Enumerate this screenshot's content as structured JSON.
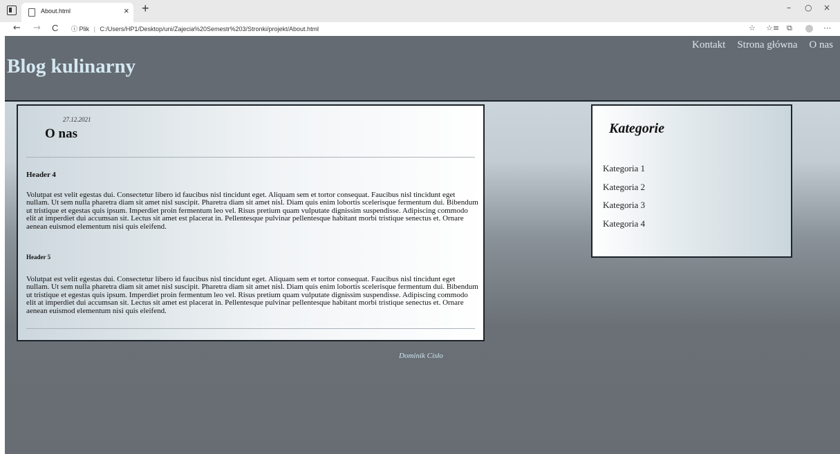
{
  "browser": {
    "tab_title": "About.html",
    "tab_close": "×",
    "new_tab": "+",
    "window_controls": [
      "–",
      "○",
      "×"
    ],
    "nav": [
      "←",
      "→",
      "C"
    ],
    "address_prefix": "Plik",
    "address": "C:/Users/HP1/Desktop/uni/Zajecia%20Semestr%203/Stronki/projekt/About.html",
    "toolbar_icons": [
      "☆",
      "☆≡",
      "⧉",
      "⋯"
    ]
  },
  "site": {
    "title": "Blog kulinarny",
    "nav": [
      "Kontakt",
      "Strona główna",
      "O nas"
    ]
  },
  "article": {
    "date": "27.12.2021",
    "title": "O nas",
    "sections": [
      {
        "heading": "Header 4",
        "text": "Volutpat est velit egestas dui. Consectetur libero id faucibus nisl tincidunt eget. Aliquam sem et tortor consequat. Faucibus nisl tincidunt eget nullam. Ut sem nulla pharetra diam sit amet nisl suscipit. Pharetra diam sit amet nisl. Diam quis enim lobortis scelerisque fermentum dui. Bibendum ut tristique et egestas quis ipsum. Imperdiet proin fermentum leo vel. Risus pretium quam vulputate dignissim suspendisse. Adipiscing commodo elit at imperdiet dui accumsan sit. Lectus sit amet est placerat in. Pellentesque pulvinar pellentesque habitant morbi tristique senectus et. Ornare aenean euismod elementum nisi quis eleifend."
      },
      {
        "heading": "Header 5",
        "text": "Volutpat est velit egestas dui. Consectetur libero id faucibus nisl tincidunt eget. Aliquam sem et tortor consequat. Faucibus nisl tincidunt eget nullam. Ut sem nulla pharetra diam sit amet nisl suscipit. Pharetra diam sit amet nisl. Diam quis enim lobortis scelerisque fermentum dui. Bibendum ut tristique et egestas quis ipsum. Imperdiet proin fermentum leo vel. Risus pretium quam vulputate dignissim suspendisse. Adipiscing commodo elit at imperdiet dui accumsan sit. Lectus sit amet est placerat in. Pellentesque pulvinar pellentesque habitant morbi tristique senectus et. Ornare aenean euismod elementum nisi quis eleifend."
      }
    ]
  },
  "sidebar": {
    "title": "Kategorie",
    "items": [
      "Kategoria 1",
      "Kategoria 2",
      "Kategoria 3",
      "Kategoria 4"
    ]
  },
  "footer": {
    "author": "Dominik Cisło"
  },
  "colors": {
    "header": "#656b72",
    "title": "#d4e8f2",
    "border": "#1c2329",
    "footer_text": "#d0e6f0"
  }
}
